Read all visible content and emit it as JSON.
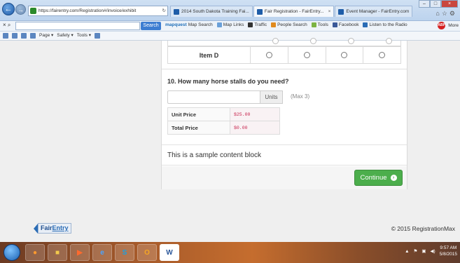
{
  "browser": {
    "url": "https://fairentry.com/Registration#/invoice/exhibit",
    "tabs": [
      {
        "label": "2014 South Dakota Training Fai..."
      },
      {
        "label": "Fair Registration - FairEntry..."
      },
      {
        "label": "Event Manager - FairEntry.com"
      }
    ],
    "search_button": "Search",
    "links": [
      "Map Search",
      "Map Links",
      "Traffic",
      "People Search",
      "Tools",
      "Facebook",
      "Listen to the Radio"
    ],
    "links_brand": "mapquest",
    "right_more": "More",
    "command_bar": [
      "Page ▾",
      "Safety ▾",
      "Tools ▾"
    ]
  },
  "survey": {
    "item_label": "Item D"
  },
  "question": {
    "title": "10. How many horse stalls do you need?",
    "input_value": "",
    "addon": "Units",
    "max_hint": "(Max 3)"
  },
  "pricing": {
    "rows": [
      {
        "label": "Unit Price",
        "value": "$25.00"
      },
      {
        "label": "Total Price",
        "value": "$0.00"
      }
    ]
  },
  "content_block": "This is a sample content block",
  "continue_button": "Continue",
  "footer": {
    "logo_part1": "Fair",
    "logo_part2": "Entry",
    "copyright": "© 2015 RegistrationMax"
  },
  "taskbar": {
    "clock_time": "9:57 AM",
    "clock_date": "5/8/2015"
  },
  "colors": {
    "accent_green": "#4cae4c",
    "price_red": "#c7254e",
    "brand_blue": "#2a6cb5"
  }
}
